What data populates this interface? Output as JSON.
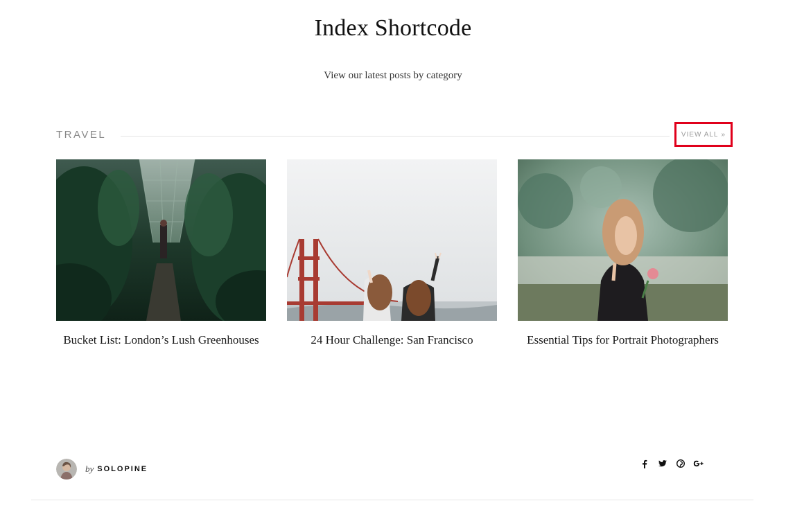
{
  "page": {
    "title": "Index Shortcode",
    "subtitle": "View our latest posts by category"
  },
  "section": {
    "label": "TRAVEL",
    "view_all_label": "VIEW ALL",
    "view_all_icon": "double-chevron-right-icon",
    "highlight_color": "#e0001b"
  },
  "posts": [
    {
      "title": "Bucket List: London’s Lush Greenhouses",
      "image": "greenhouse-photo"
    },
    {
      "title": "24 Hour Challenge: San Francisco",
      "image": "golden-gate-bridge-photo"
    },
    {
      "title": "Essential Tips for Portrait Photographers",
      "image": "portrait-woman-photo"
    }
  ],
  "author": {
    "prefix": "by",
    "name": "SOLOPINE"
  },
  "share_icons": [
    "facebook-icon",
    "twitter-icon",
    "pinterest-icon",
    "google-plus-icon"
  ]
}
